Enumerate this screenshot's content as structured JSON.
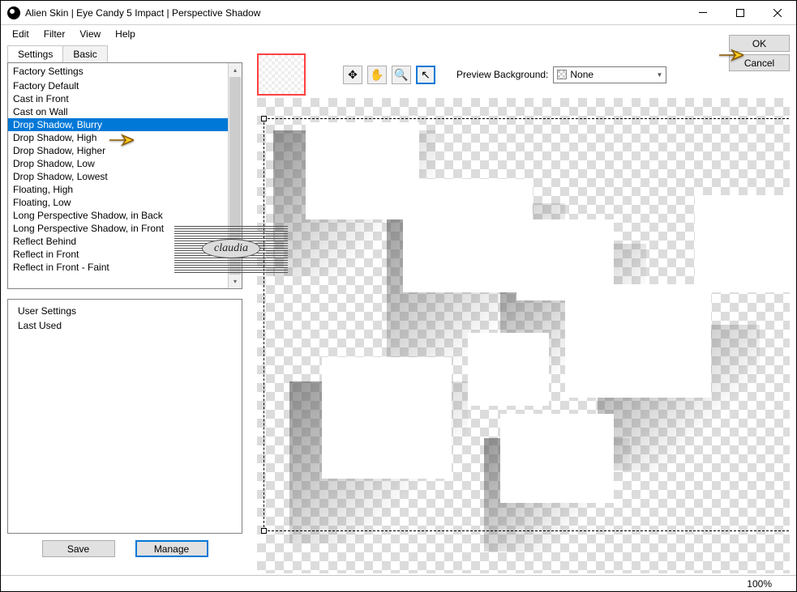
{
  "title": "Alien Skin | Eye Candy 5 Impact | Perspective Shadow",
  "menu": [
    "Edit",
    "Filter",
    "View",
    "Help"
  ],
  "tabs": {
    "active": "Settings",
    "inactive": "Basic"
  },
  "factory": {
    "header": "Factory Settings",
    "items": [
      "Factory Default",
      "Cast in Front",
      "Cast on Wall",
      "Drop Shadow, Blurry",
      "Drop Shadow, High",
      "Drop Shadow, Higher",
      "Drop Shadow, Low",
      "Drop Shadow, Lowest",
      "Floating, High",
      "Floating, Low",
      "Long Perspective Shadow, in Back",
      "Long Perspective Shadow, in Front",
      "Reflect Behind",
      "Reflect in Front",
      "Reflect in Front - Faint"
    ],
    "selected_index": 3
  },
  "user": {
    "header": "User Settings",
    "items": [
      "Last Used"
    ]
  },
  "buttons": {
    "save": "Save",
    "manage": "Manage",
    "ok": "OK",
    "cancel": "Cancel"
  },
  "preview_bg": {
    "label": "Preview Background:",
    "value": "None"
  },
  "zoom": "100%",
  "watermark": "claudia"
}
